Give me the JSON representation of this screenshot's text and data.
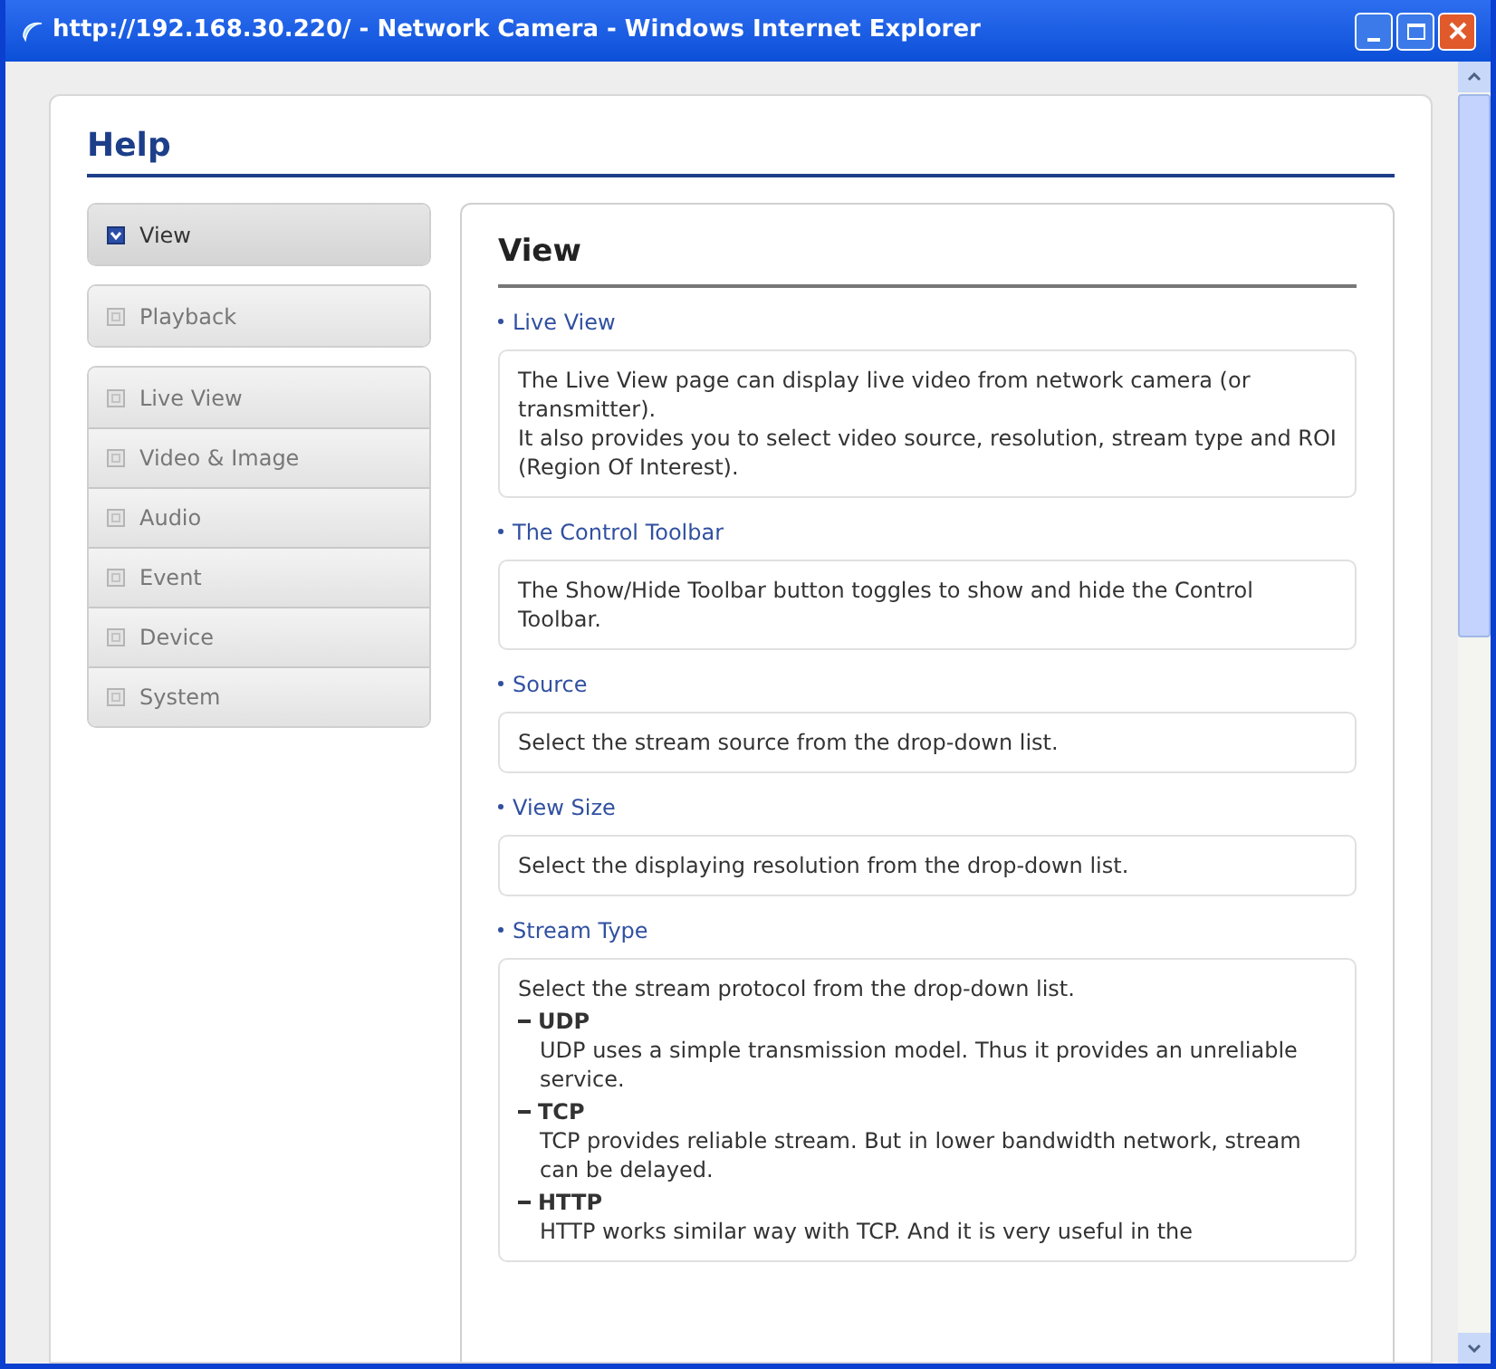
{
  "window": {
    "title": "http://192.168.30.220/ - Network Camera - Windows Internet Explorer"
  },
  "page_title": "Help",
  "sidebar": {
    "groups": [
      {
        "items": [
          {
            "label": "View",
            "selected": true
          }
        ]
      },
      {
        "items": [
          {
            "label": "Playback",
            "selected": false
          }
        ]
      },
      {
        "items": [
          {
            "label": "Live View",
            "selected": false
          },
          {
            "label": "Video & Image",
            "selected": false
          },
          {
            "label": "Audio",
            "selected": false
          },
          {
            "label": "Event",
            "selected": false
          },
          {
            "label": "Device",
            "selected": false
          },
          {
            "label": "System",
            "selected": false
          }
        ]
      }
    ]
  },
  "content": {
    "title": "View",
    "sections": [
      {
        "heading": "Live View",
        "paragraphs": [
          "The Live View page can display live video from network camera (or transmitter).",
          "It also provides you to select video source, resolution, stream type and ROI (Region Of Interest)."
        ]
      },
      {
        "heading": "The Control Toolbar",
        "paragraphs": [
          "The Show/Hide Toolbar button toggles to show and hide the Control Toolbar."
        ]
      },
      {
        "heading": "Source",
        "paragraphs": [
          "Select the stream source from the drop-down list."
        ]
      },
      {
        "heading": "View Size",
        "paragraphs": [
          "Select the displaying resolution from the drop-down list."
        ]
      },
      {
        "heading": "Stream Type",
        "paragraphs": [
          "Select the stream protocol from the drop-down list."
        ],
        "options": [
          {
            "name": "UDP",
            "description": "UDP uses a simple transmission model. Thus it provides an unreliable service."
          },
          {
            "name": "TCP",
            "description": "TCP provides reliable stream. But in lower bandwidth network, stream can be delayed."
          },
          {
            "name": "HTTP",
            "description": "HTTP works similar way with TCP. And it is very useful in the"
          }
        ]
      }
    ]
  }
}
